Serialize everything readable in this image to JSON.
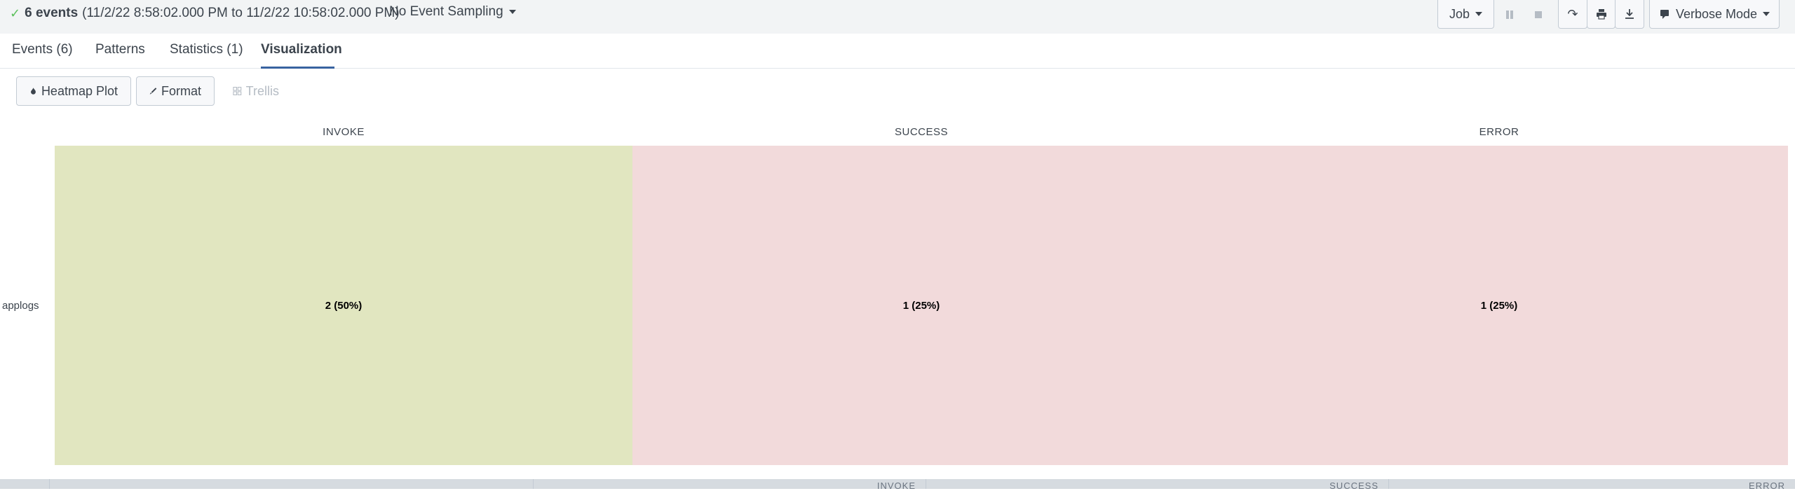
{
  "status": {
    "check_icon": "check-icon",
    "event_count": "6 events",
    "time_range": "(11/2/22 8:58:02.000 PM to 11/2/22 10:58:02.000 PM)",
    "sampling": "No Event Sampling"
  },
  "toolbar": {
    "job_label": "Job",
    "mode_label": "Verbose Mode"
  },
  "tabs": [
    {
      "label": "Events (6)"
    },
    {
      "label": "Patterns"
    },
    {
      "label": "Statistics (1)"
    },
    {
      "label": "Visualization"
    }
  ],
  "viz_toolbar": {
    "heatmap_label": "Heatmap Plot",
    "format_label": "Format",
    "trellis_label": "Trellis"
  },
  "chart_data": {
    "type": "heatmap",
    "columns": [
      "INVOKE",
      "SUCCESS",
      "ERROR"
    ],
    "rows": [
      "applogs"
    ],
    "values": [
      [
        2,
        1,
        1
      ]
    ],
    "cell_labels": [
      [
        "2 (50%)",
        "1 (25%)",
        "1 (25%)"
      ]
    ],
    "colors": [
      "#e1e6c0",
      "#f2dadb",
      "#f2dadb"
    ]
  },
  "bottom_header": {
    "columns": [
      "INVOKE",
      "SUCCESS",
      "ERROR"
    ]
  }
}
